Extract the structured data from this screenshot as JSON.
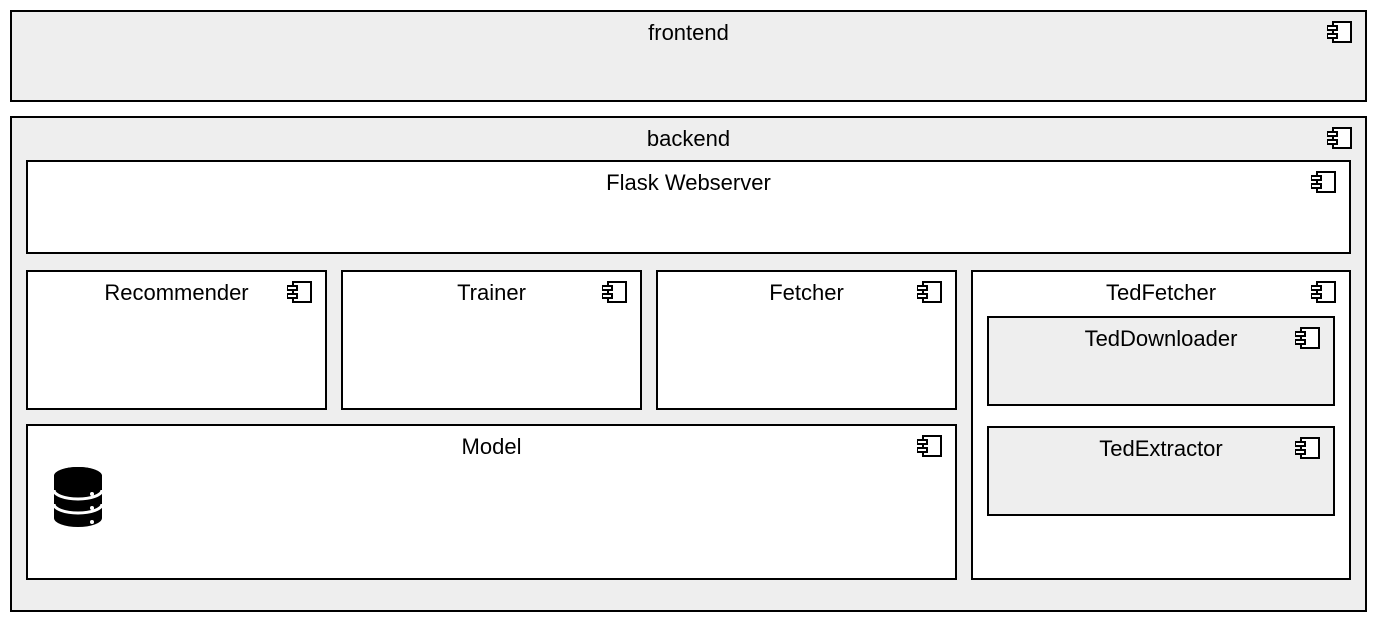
{
  "frontend": {
    "label": "frontend"
  },
  "backend": {
    "label": "backend",
    "flask": {
      "label": "Flask Webserver"
    },
    "recommender": {
      "label": "Recommender"
    },
    "trainer": {
      "label": "Trainer"
    },
    "fetcher": {
      "label": "Fetcher"
    },
    "model": {
      "label": "Model"
    },
    "tedfetcher": {
      "label": "TedFetcher",
      "teddownloader": {
        "label": "TedDownloader"
      },
      "tedextractor": {
        "label": "TedExtractor"
      }
    }
  }
}
